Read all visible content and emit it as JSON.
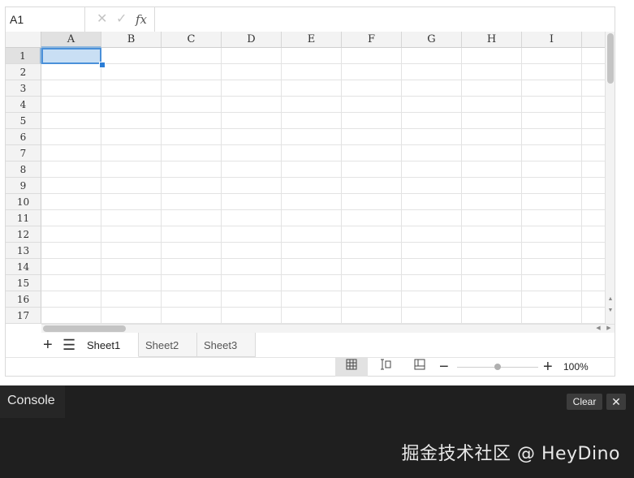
{
  "formula_bar": {
    "name_box": "A1",
    "cancel_icon": "close-x",
    "confirm_icon": "check",
    "fx_label": "fx",
    "value": ""
  },
  "grid": {
    "columns": [
      "A",
      "B",
      "C",
      "D",
      "E",
      "F",
      "G",
      "H",
      "I"
    ],
    "rows": [
      "1",
      "2",
      "3",
      "4",
      "5",
      "6",
      "7",
      "8",
      "9",
      "10",
      "11",
      "12",
      "13",
      "14",
      "15",
      "16",
      "17"
    ],
    "active_cell": "A1",
    "selection_color": "#4a90d9"
  },
  "tab_bar": {
    "add_icon": "plus",
    "menu_icon": "hamburger-menu",
    "tabs": [
      "Sheet1",
      "Sheet2",
      "Sheet3"
    ],
    "active_tab": "Sheet1"
  },
  "status_bar": {
    "views": [
      "normal-view",
      "page-break-view",
      "page-layout-view"
    ],
    "active_view": "normal-view",
    "zoom_out_icon": "minus",
    "zoom_in_icon": "plus",
    "zoom_level": 1.0,
    "zoom_label": "100%"
  },
  "console": {
    "title": "Console",
    "clear_label": "Clear",
    "close_icon": "close-x"
  },
  "watermark": "掘金技术社区 @ HeyDino"
}
